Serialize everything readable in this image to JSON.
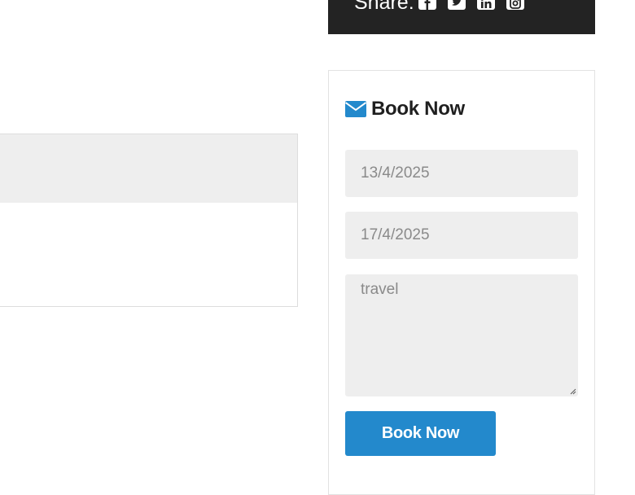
{
  "share": {
    "label": "Share:",
    "icons": [
      "facebook-icon",
      "twitter-icon",
      "linkedin-icon",
      "instagram-icon"
    ]
  },
  "booking": {
    "title": "Book Now",
    "title_icon": "envelope-icon",
    "date_from": "13/4/2025",
    "date_to": "17/4/2025",
    "message": "travel",
    "button_label": "Book Now"
  },
  "colors": {
    "accent": "#2389cc",
    "share_bar_bg": "#232323",
    "field_bg": "#eeeeee",
    "card_header_bg": "#eeeeee"
  }
}
